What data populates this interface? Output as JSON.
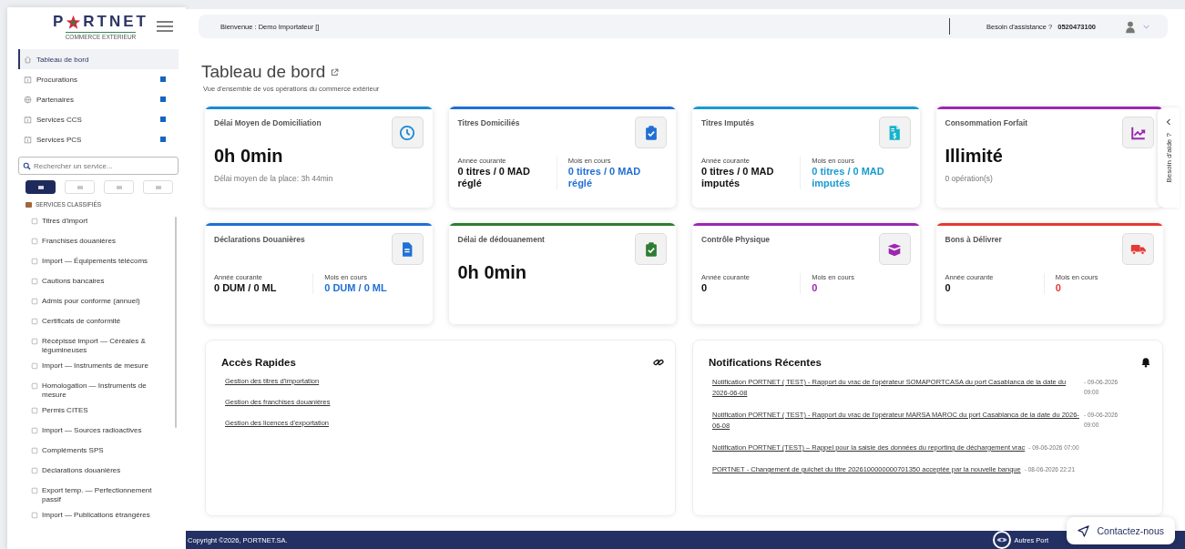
{
  "logo": {
    "text_start": "P",
    "text_end": "RTNET",
    "tagline": "COMMERCE EXTERIEUR"
  },
  "nav": [
    {
      "label": "Tableau de bord",
      "selected": true,
      "expandable": false
    },
    {
      "label": "Procurations",
      "selected": false,
      "expandable": true
    },
    {
      "label": "Partenaires",
      "selected": false,
      "expandable": true
    },
    {
      "label": "Services CCS",
      "selected": false,
      "expandable": true
    },
    {
      "label": "Services PCS",
      "selected": false,
      "expandable": true
    }
  ],
  "search": {
    "placeholder": "Rechercher un service..."
  },
  "filters": [
    {
      "selected": true
    },
    {
      "selected": false
    },
    {
      "selected": false
    },
    {
      "selected": false
    }
  ],
  "services_heading": "SERVICES CLASSIFIÉS",
  "services": [
    "Titres d'import",
    "Franchises douanières",
    "Import — Équipements télécoms",
    "Cautions bancaires",
    "Admis pour conforme (annuel)",
    "Certificats de conformité",
    "Récépissé import — Céréales & légumineuses",
    "Import — Instruments de mesure",
    "Homologation — Instruments de mesure",
    "Permis CITES",
    "Import — Sources radioactives",
    "Compléments SPS",
    "Déclarations douanières",
    "Export temp. — Perfectionnement passif",
    "Import — Publications étrangères"
  ],
  "topbar": {
    "welcome": "Bienvenue : Demo Importateur []",
    "assistance_label": "Besoin d'assistance ?",
    "phone": "0520473100"
  },
  "page": {
    "title": "Tableau de bord",
    "subtitle": "Vue d'ensemble de vos opérations du commerce extérieur"
  },
  "cards": [
    {
      "kind": "single",
      "title": "Délai Moyen de Domiciliation",
      "color": "#1a8bd4",
      "value": "0h 0min",
      "note": "Délai moyen de la place: 3h 44min"
    },
    {
      "kind": "split",
      "title": "Titres Domiciliés",
      "color": "#1f6fd6",
      "year_label": "Année courante",
      "year_value": "0 titres / 0 MAD réglé",
      "month_label": "Mois en cours",
      "month_value": "0 titres / 0 MAD réglé"
    },
    {
      "kind": "split",
      "title": "Titres Imputés",
      "color": "#1a9bd0",
      "year_label": "Année courante",
      "year_value": "0 titres / 0 MAD imputés",
      "month_label": "Mois en cours",
      "month_value": "0 titres / 0 MAD imputés"
    },
    {
      "kind": "single",
      "title": "Consommation Forfait",
      "color": "#9c27b0",
      "value": "Illimité",
      "note": "0 opération(s)"
    },
    {
      "kind": "split",
      "title": "Déclarations Douanières",
      "color": "#1f6fd6",
      "year_label": "Année courante",
      "year_value": "0 DUM / 0 ML",
      "month_label": "Mois en cours",
      "month_value": "0 DUM / 0 ML"
    },
    {
      "kind": "single",
      "title": "Délai de dédouanement",
      "color": "#2e7d32",
      "value": "0h 0min"
    },
    {
      "kind": "split",
      "title": "Contrôle Physique",
      "color": "#9c27b0",
      "year_label": "Année courante",
      "year_value": "0",
      "month_label": "Mois en cours",
      "month_value": "0"
    },
    {
      "kind": "split",
      "title": "Bons à Délivrer",
      "color": "#e53935",
      "year_label": "Année courante",
      "year_value": "0",
      "month_label": "Mois en cours",
      "month_value": "0"
    }
  ],
  "quick_access": {
    "title": "Accès Rapides",
    "links": [
      "Gestion des titres d'importation",
      "Gestion des franchises douanières",
      "Gestion des licences d'exportation"
    ]
  },
  "notifications": {
    "title": "Notifications Récentes",
    "items": [
      {
        "text": "Notification PORTNET ( TEST) - Rapport du vrac de l'opérateur SOMAPORTCASA du port Casablanca de la date du 2026-06-08",
        "date": "- 09-06-2026 09:00"
      },
      {
        "text": "Notification PORTNET ( TEST) - Rapport du vrac de l'opérateur MARSA MAROC du port Casablanca de la date du 2026-06-08",
        "date": "- 09-06-2026 09:00"
      },
      {
        "text": "Notification PORTNET (TEST) – Rappel pour la saisie des données du reporting de déchargement vrac",
        "date": "- 09-06-2026 07:00"
      },
      {
        "text": "PORTNET - Changement de guichet du titre 2026100000000701350 acceptée par la nouvelle banque",
        "date": "- 08-06-2026 22:21"
      }
    ]
  },
  "help_tab": "Besoin d'aide ?",
  "footer": {
    "copyright": "Copyright ©2026, PORTNET.SA.",
    "other_portals": "Autres Port"
  },
  "contact_button": "Contactez-nous"
}
